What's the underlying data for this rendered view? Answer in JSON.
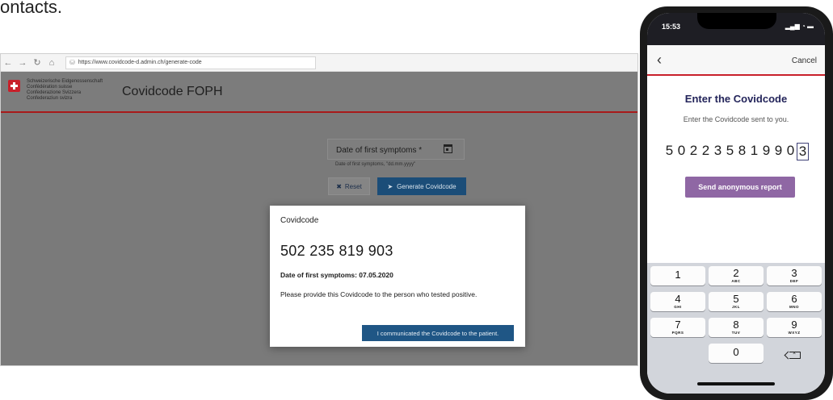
{
  "caption": "ontacts.",
  "browser": {
    "url": "https://www.covidcode-d.admin.ch/generate-code",
    "nav_icons": [
      "back-icon",
      "forward-icon",
      "refresh-icon",
      "home-icon"
    ],
    "confederation_lines": [
      "Schweizerische Eidgenossenschaft",
      "Confédération suisse",
      "Confederazione Svizzera",
      "Confederaziun svizra"
    ],
    "site_title": "Covidcode FOPH",
    "date_field_label": "Date of first symptoms *",
    "date_hint": "Date of first symptoms, \"dd.mm.yyyy\"",
    "reset_label": "Reset",
    "generate_label": "Generate Covidcode",
    "modal": {
      "title": "Covidcode",
      "code": "502 235 819 903",
      "date_line": "Date of first symptoms: 07.05.2020",
      "instruction": "Please provide this Covidcode to the person who tested positive.",
      "confirm_label": "I communicated the Covidcode to the patient."
    }
  },
  "phone": {
    "time": "15:53",
    "signal": "▂▄▆ ◔ ▬",
    "back_icon": "chevron-left-icon",
    "cancel_label": "Cancel",
    "title": "Enter the Covidcode",
    "subtitle": "Enter the Covidcode sent to you.",
    "digits": [
      "5",
      "0",
      "2",
      "2",
      "3",
      "5",
      "8",
      "1",
      "9",
      "9",
      "0",
      "3"
    ],
    "send_label": "Send anonymous report",
    "keys": [
      {
        "n": "1",
        "l": ""
      },
      {
        "n": "2",
        "l": "ABC"
      },
      {
        "n": "3",
        "l": "DEF"
      },
      {
        "n": "4",
        "l": "GHI"
      },
      {
        "n": "5",
        "l": "JKL"
      },
      {
        "n": "6",
        "l": "MNO"
      },
      {
        "n": "7",
        "l": "PQRS"
      },
      {
        "n": "8",
        "l": "TUV"
      },
      {
        "n": "9",
        "l": "WXYZ"
      },
      {
        "n": "0",
        "l": ""
      }
    ]
  },
  "colors": {
    "swiss_red": "#c8202a",
    "primary_blue": "#1f5685",
    "phone_title": "#23245a",
    "send_button": "#8f67a4"
  }
}
